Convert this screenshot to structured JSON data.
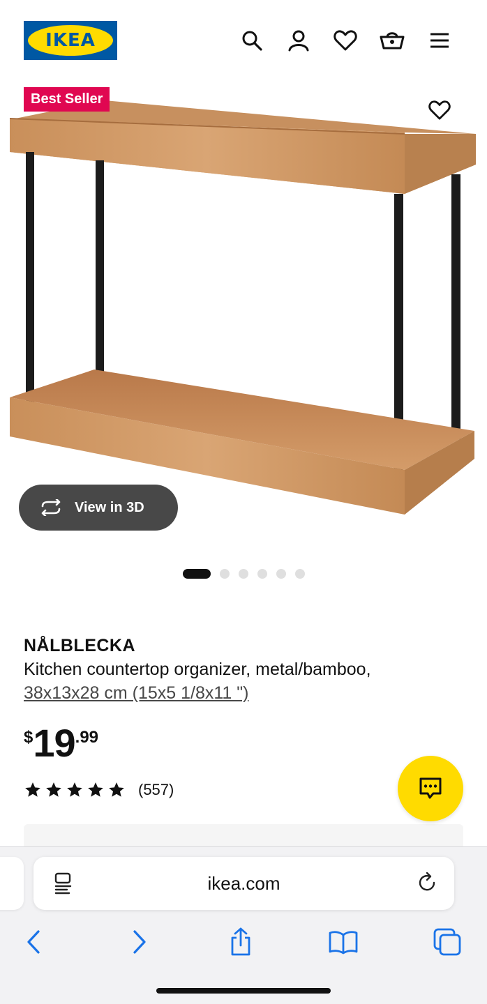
{
  "header": {
    "logo_text": "IKEA",
    "icons": [
      "search-icon",
      "account-icon",
      "heart-icon",
      "cart-icon",
      "menu-icon"
    ]
  },
  "product_image": {
    "badge": "Best Seller",
    "view3d_label": "View in 3D",
    "carousel": {
      "total": 6,
      "active": 1
    }
  },
  "product": {
    "name": "NÅLBLECKA",
    "description": "Kitchen countertop organizer, metal/bamboo,",
    "dimensions": "38x13x28 cm (15x5 1/8x11 \")",
    "price": {
      "currency": "$",
      "integer": "19",
      "decimal": ".99"
    },
    "rating": {
      "stars": 5,
      "count_label": "(557)"
    }
  },
  "colors": {
    "ikea_blue": "#0058a3",
    "ikea_yellow": "#ffdb00",
    "badge_red": "#e00751",
    "ios_blue": "#1a73e8"
  },
  "browser": {
    "url": "ikea.com",
    "toolbar": [
      "back-icon",
      "forward-icon",
      "share-icon",
      "bookmarks-icon",
      "tabs-icon"
    ]
  }
}
